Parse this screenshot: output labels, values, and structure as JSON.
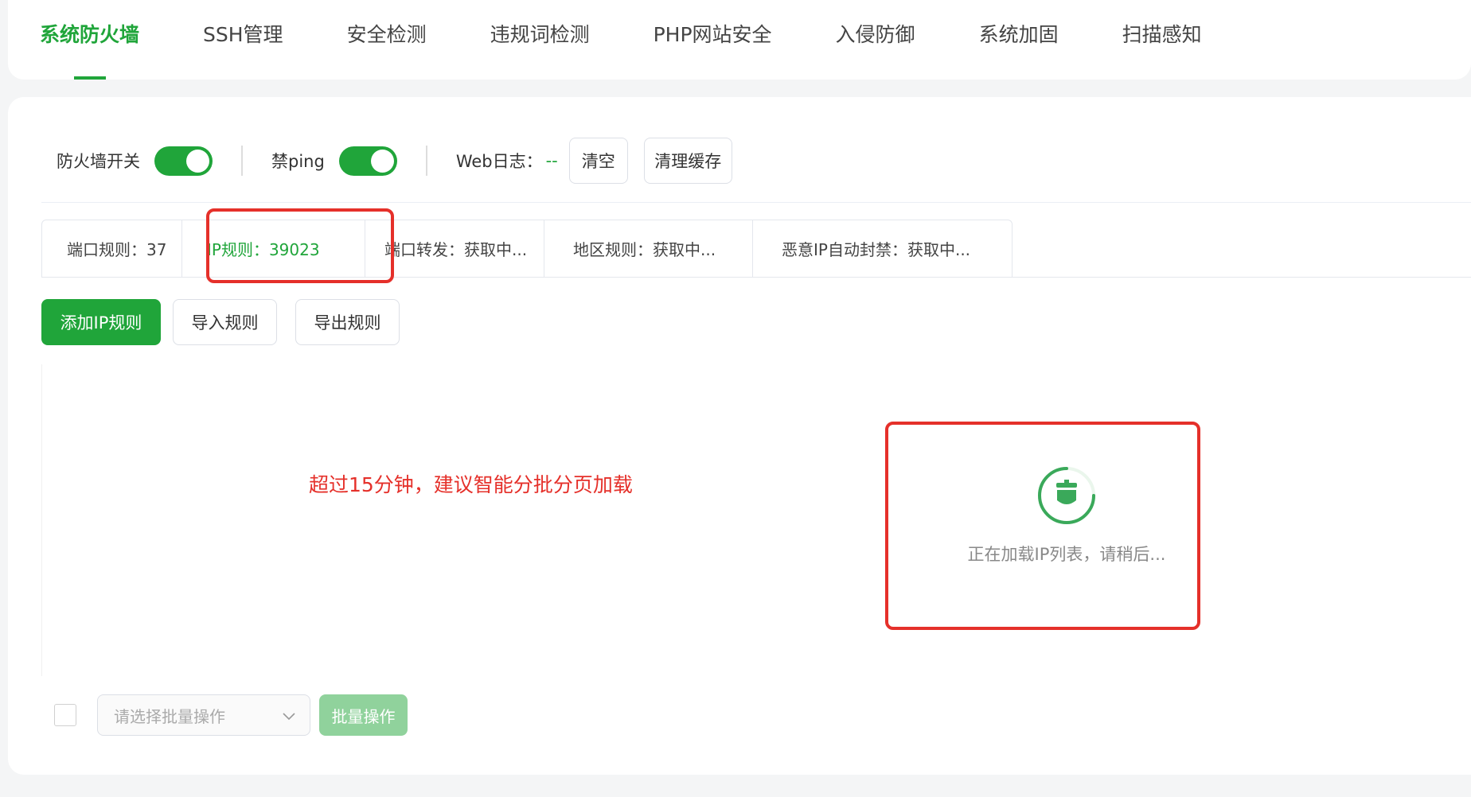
{
  "nav": {
    "tabs": [
      {
        "label": "系统防火墙",
        "active": true
      },
      {
        "label": "SSH管理"
      },
      {
        "label": "安全检测"
      },
      {
        "label": "违规词检测"
      },
      {
        "label": "PHP网站安全"
      },
      {
        "label": "入侵防御"
      },
      {
        "label": "系统加固"
      },
      {
        "label": "扫描感知"
      }
    ]
  },
  "toolbar": {
    "firewall_label": "防火墙开关",
    "firewall_on": true,
    "ping_label": "禁ping",
    "ping_on": true,
    "weblog_label": "Web日志：",
    "weblog_value": "--",
    "clear_label": "清空",
    "clear_cache_label": "清理缓存"
  },
  "rule_tabs": [
    {
      "label": "端口规则：37"
    },
    {
      "label": "IP规则：39023",
      "active": true
    },
    {
      "label": "端口转发：获取中..."
    },
    {
      "label": "地区规则：获取中..."
    },
    {
      "label": "恶意IP自动封禁：获取中..."
    }
  ],
  "actions": {
    "add_label": "添加IP规则",
    "import_label": "导入规则",
    "export_label": "导出规则"
  },
  "annotation": "超过15分钟，建议智能分批分页加载",
  "loading": {
    "text": "正在加载IP列表，请稍后..."
  },
  "footer": {
    "select_placeholder": "请选择批量操作",
    "batch_label": "批量操作"
  },
  "colors": {
    "accent": "#20a53a",
    "annotation_red": "#e5302a"
  }
}
